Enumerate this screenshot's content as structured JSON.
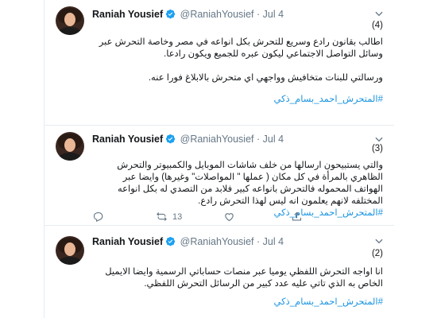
{
  "tweets": [
    {
      "name": "Raniah Yousief",
      "handle": "@RaniahYousief",
      "dot": "·",
      "date": "Jul 4",
      "number": "(4)",
      "paragraphs": [
        "اطالب بقانون رادع وسريع للتحرش بكل انواعه في مصر وخاصة التحرش عبر وسائل التواصل الاجتماعي ليكون عبره للجميع ويكون رادعا.",
        "ورسالتي للبنات متخافيش وواجهي اي متحرش بالابلاغ فورا عنه."
      ],
      "hashtag": "#المتحرش_احمد_بسام_ذكي"
    },
    {
      "name": "Raniah Yousief",
      "handle": "@RaniahYousief",
      "dot": "·",
      "date": "Jul 4",
      "number": "(3)",
      "paragraphs": [
        "والتي يستبيحون ارسالها من خلف شاشات الموبايل والكمبيوتر والتحرش الظاهري بالمرأة في كل مكان ( عملها \" المواصلات\" وغيرها) وايضا عبر الهواتف المحموله فالتحرش بانواعه كبير فلابد من التصدي له بكل انواعه المختلفه لانهم يعلمون انه ليس لهذا التحرش رادع."
      ],
      "hashtag": "#المتحرش_احمد_بسام_ذكي",
      "retweets": "13"
    },
    {
      "name": "Raniah Yousief",
      "handle": "@RaniahYousief",
      "dot": "·",
      "date": "Jul 4",
      "number": "(2)",
      "paragraphs": [
        "انا اواجه التحرش اللفظي يوميا عبر منصات حساباتي الرسمية وايضا الايميل الخاص به الذي تاتي عليه عدد كبير من الرسائل التحرش اللفظي."
      ],
      "hashtag": "#المتحرش_احمد_بسام_ذكي"
    }
  ],
  "colors": {
    "verified": "#1da1f2",
    "link": "#1b95e0",
    "muted": "#657786"
  },
  "icons": [
    "verified-badge-icon",
    "chevron-down-icon",
    "reply-icon",
    "retweet-icon",
    "like-icon",
    "share-icon"
  ]
}
